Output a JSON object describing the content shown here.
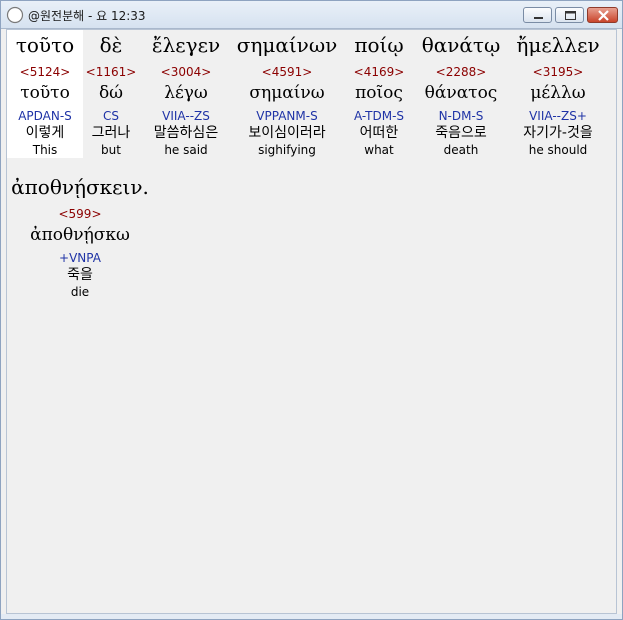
{
  "window": {
    "title": "@원전분해 - 요 12:33"
  },
  "words": [
    {
      "greek": "τοῦτο",
      "strong": "<5124>",
      "lemma": "τοῦτο",
      "parse": "APDAN-S",
      "korean": "이렇게",
      "english": "This"
    },
    {
      "greek": "δὲ",
      "strong": "<1161>",
      "lemma": "δώ",
      "parse": "CS",
      "korean": "그러나",
      "english": "but"
    },
    {
      "greek": "ἔλεγεν",
      "strong": "<3004>",
      "lemma": "λέγω",
      "parse": "VIIA--ZS",
      "korean": "말씀하심은",
      "english": "he said"
    },
    {
      "greek": "σημαίνων",
      "strong": "<4591>",
      "lemma": "σημαίνω",
      "parse": "VPPANM-S",
      "korean": "보이심이러라",
      "english": "sighifying"
    },
    {
      "greek": "ποίῳ",
      "strong": "<4169>",
      "lemma": "ποῖος",
      "parse": "A-TDM-S",
      "korean": "어떠한",
      "english": "what"
    },
    {
      "greek": "θανάτῳ",
      "strong": "<2288>",
      "lemma": "θάνατος",
      "parse": "N-DM-S",
      "korean": "죽음으로",
      "english": "death"
    },
    {
      "greek": "ἤμελλεν",
      "strong": "<3195>",
      "lemma": "μέλλω",
      "parse": "VIIA--ZS+",
      "korean": "자기가-것을",
      "english": "he should"
    },
    {
      "greek": "ἀποθνῄσκειν.",
      "strong": "<599>",
      "lemma": "ἀποθνῄσκω",
      "parse": "+VNPA",
      "korean": "죽을",
      "english": "die"
    }
  ],
  "colors": {
    "strong": "#8b0000",
    "parse": "#1f33a6",
    "selected_background": "#ffffff"
  },
  "icons": {
    "app": "compass-icon",
    "minimize": "minimize-icon",
    "maximize": "maximize-icon",
    "close": "close-icon"
  }
}
